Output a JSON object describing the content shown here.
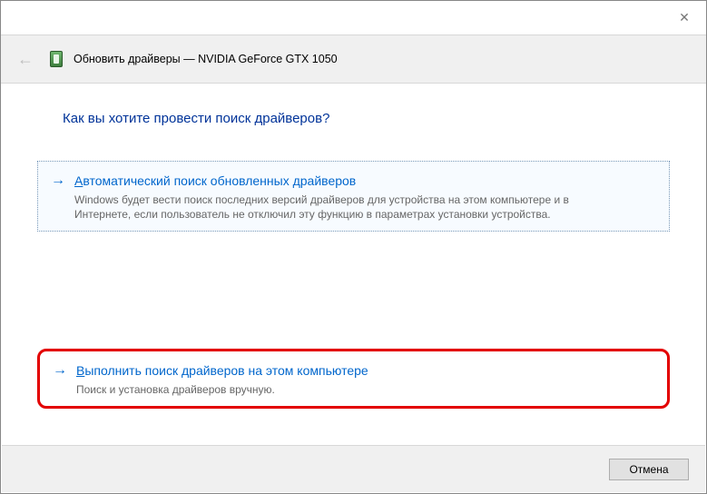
{
  "titlebar": {
    "close_glyph": "✕"
  },
  "header": {
    "back_glyph": "←",
    "title": "Обновить драйверы — NVIDIA GeForce GTX 1050"
  },
  "question": "Как вы хотите провести поиск драйверов?",
  "options": {
    "auto": {
      "arrow": "→",
      "title_underline_char": "А",
      "title_rest": "втоматический поиск обновленных драйверов",
      "desc": "Windows будет вести поиск последних версий драйверов для устройства на этом компьютере и в Интернете, если пользователь не отключил эту функцию в параметрах установки устройства."
    },
    "manual": {
      "arrow": "→",
      "title_underline_char": "В",
      "title_rest": "ыполнить поиск драйверов на этом компьютере",
      "desc": "Поиск и установка драйверов вручную."
    }
  },
  "footer": {
    "cancel_label": "Отмена"
  }
}
